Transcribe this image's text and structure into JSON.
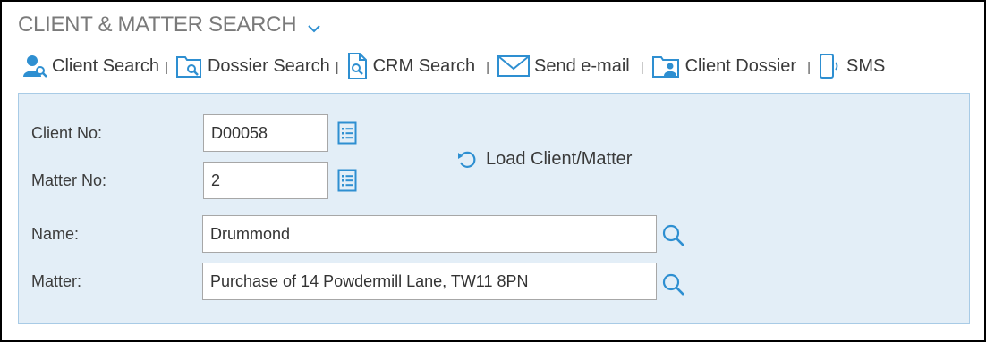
{
  "header": {
    "title": "CLIENT & MATTER SEARCH"
  },
  "toolbar": {
    "client_search": "Client Search",
    "dossier_search": "Dossier Search",
    "crm_search": "CRM Search",
    "send_email": "Send e-mail",
    "client_dossier": "Client Dossier",
    "sms": "SMS",
    "separator": "|"
  },
  "form": {
    "client_no_label": "Client No:",
    "client_no_value": "D00058",
    "matter_no_label": "Matter No:",
    "matter_no_value": "2",
    "name_label": "Name:",
    "name_value": "Drummond",
    "matter_label": "Matter:",
    "matter_value": "Purchase of 14 Powdermill Lane, TW11 8PN",
    "load_label": "Load Client/Matter"
  },
  "icons": {
    "accent": "#2e8fd1",
    "title_chevron": "chevron-down-icon",
    "client_search": "user-search-icon",
    "dossier_search": "folder-search-icon",
    "crm_search": "document-search-icon",
    "send_email": "envelope-icon",
    "client_dossier": "folder-user-icon",
    "sms": "phone-icon",
    "lookup": "list-icon",
    "search": "magnifier-icon",
    "load": "refresh-icon"
  },
  "colors": {
    "panel_bg": "#e3eef7",
    "panel_border": "#a8cbe6",
    "title_text": "#7a7a7a"
  }
}
